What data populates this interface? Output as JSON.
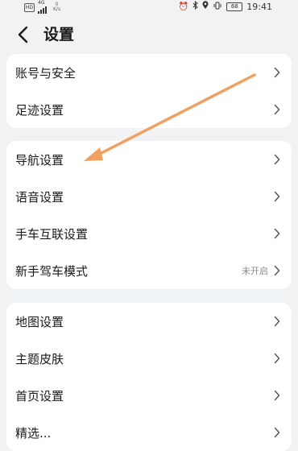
{
  "status_bar": {
    "hd": "HD",
    "network": "4G",
    "speed_value": "0",
    "speed_unit": "K/s",
    "battery": "68",
    "time": "19:41"
  },
  "header": {
    "title": "设置"
  },
  "sections": [
    {
      "items": [
        {
          "label": "账号与安全"
        },
        {
          "label": "足迹设置"
        }
      ]
    },
    {
      "items": [
        {
          "label": "导航设置"
        },
        {
          "label": "语音设置"
        },
        {
          "label": "手车互联设置"
        },
        {
          "label": "新手驾车模式",
          "value": "未开启"
        }
      ]
    },
    {
      "items": [
        {
          "label": "地图设置"
        },
        {
          "label": "主题皮肤"
        },
        {
          "label": "首页设置"
        },
        {
          "label": "精选..."
        }
      ]
    }
  ],
  "colors": {
    "background": "#f1f2f4",
    "card": "#ffffff",
    "annotation_arrow": "#f0a060"
  }
}
